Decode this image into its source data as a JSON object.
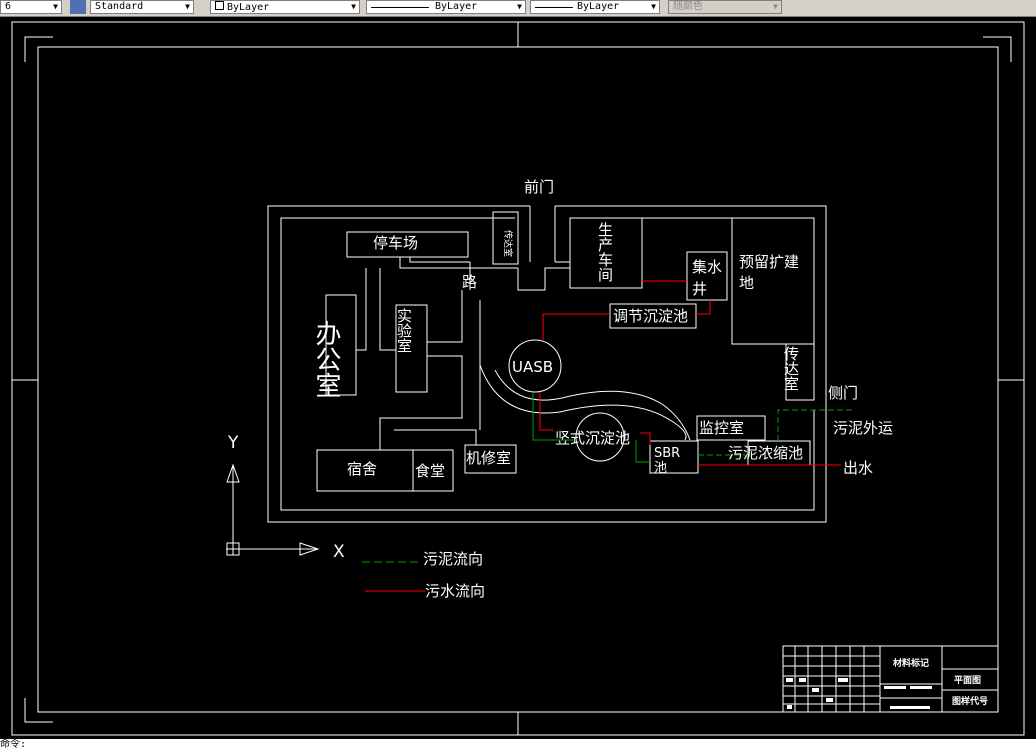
{
  "toolbar": {
    "partial_left": "6",
    "text_style": "Standard",
    "layer": "ByLayer",
    "linetype": "ByLayer",
    "lineweight": "ByLayer",
    "plot_style": "随颜色"
  },
  "drawing": {
    "front_gate": "前门",
    "side_gate": "侧门",
    "parking": "停车场",
    "guard_room_left": "传达室",
    "road": "路",
    "office": "办公室",
    "lab": "实验室",
    "production_workshop": "生产车间",
    "collection_well": "集水井",
    "reserved_land": "预留扩建地",
    "regulating_tank": "调节沉淀池",
    "uasb": "UASB",
    "guard_room_right": "传达室",
    "vertical_settling": "竖式沉淀池",
    "monitoring_room": "监控室",
    "sbr_tank": "SBR池",
    "sludge_thickener": "污泥浓缩池",
    "sludge_export": "污泥外运",
    "outlet": "出水",
    "dormitory": "宿舍",
    "canteen": "食堂",
    "machine_room": "机修室",
    "axis_y": "Y",
    "axis_x": "X"
  },
  "legend": {
    "sludge_flow": "污泥流向",
    "sewage_flow": "污水流向",
    "sludge_color": "#00a000",
    "sewage_color": "#ff0000"
  },
  "title_block": {
    "material_label": "材料标记",
    "plan_label": "平面图",
    "drawing_code_label": "图样代号"
  },
  "status": {
    "command_text": "命令:"
  }
}
